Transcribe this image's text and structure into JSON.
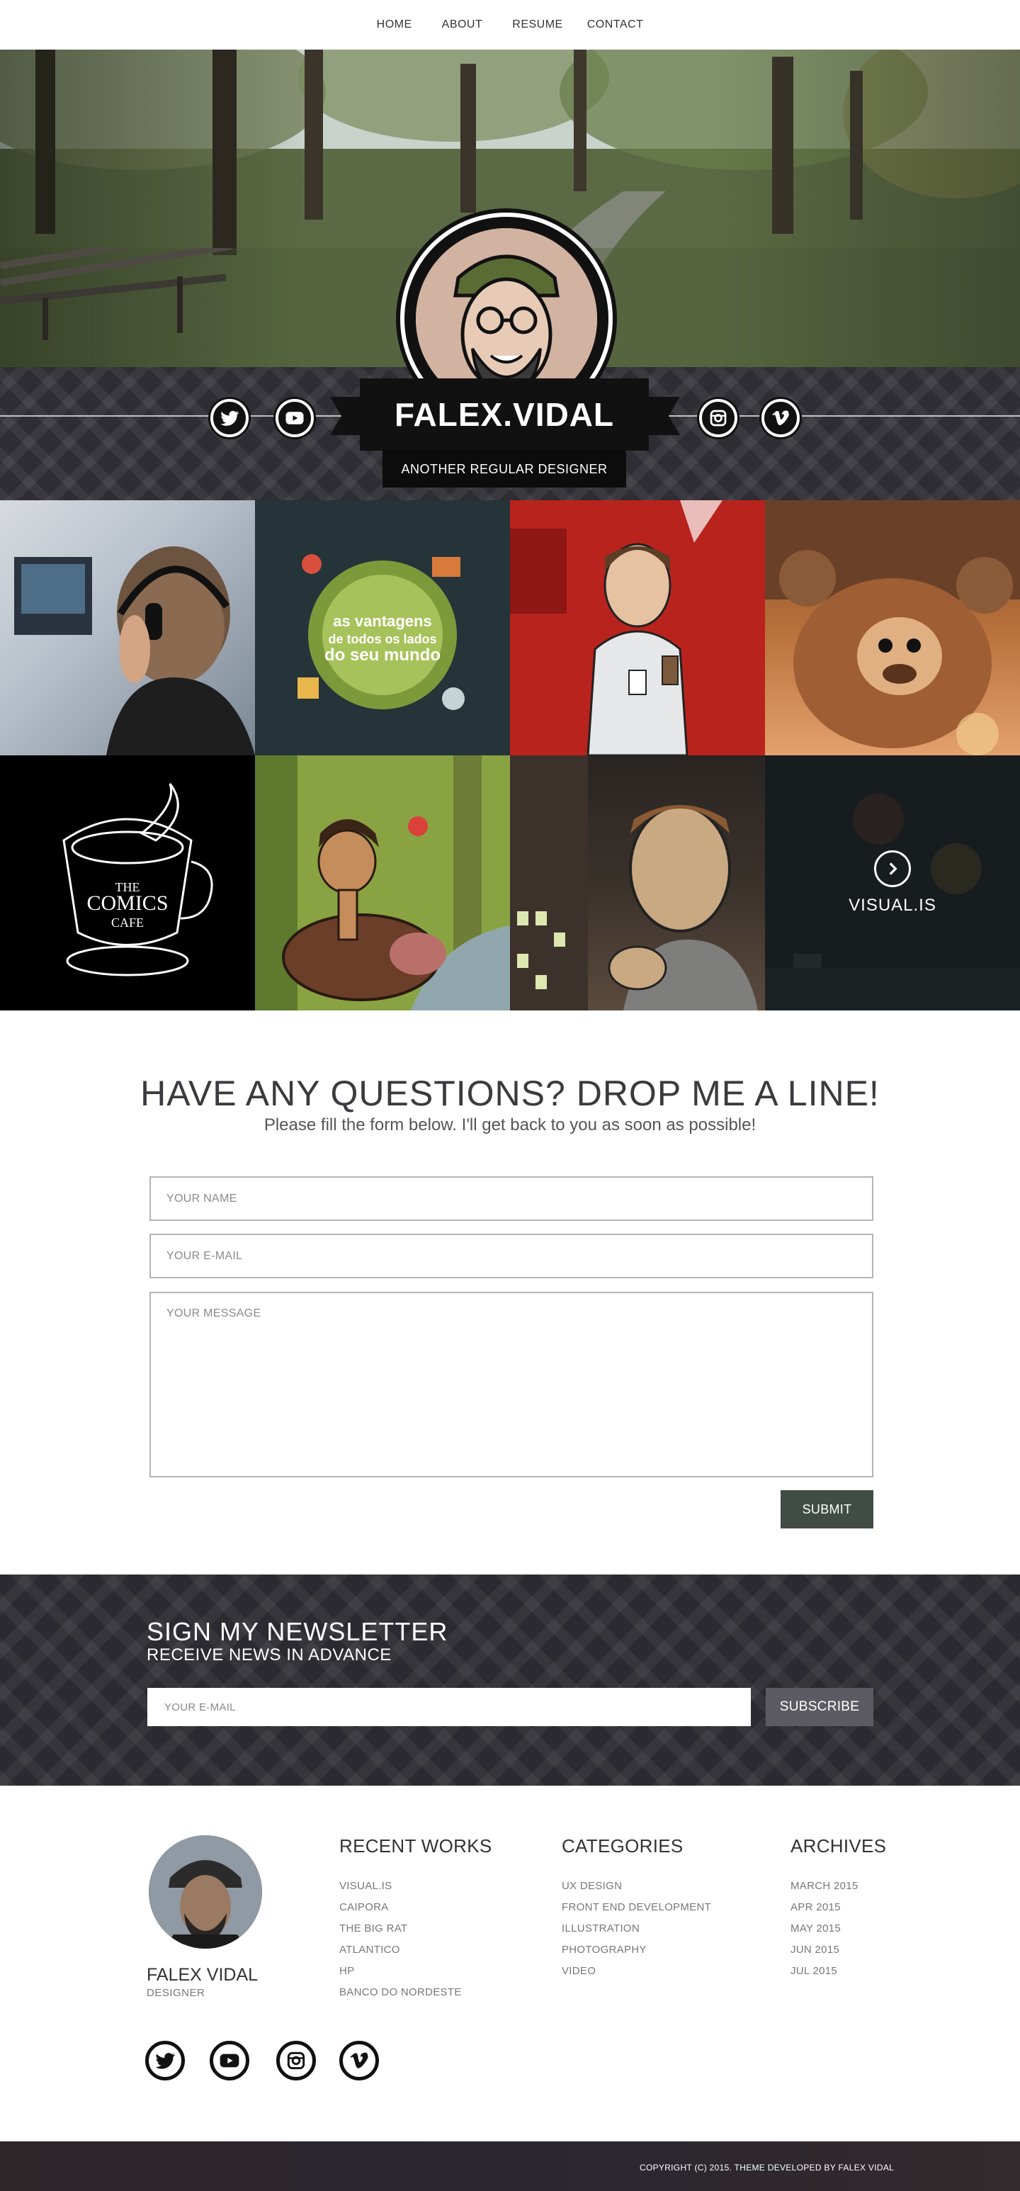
{
  "nav": {
    "items": [
      {
        "label": "HOME"
      },
      {
        "label": "ABOUT"
      },
      {
        "label": "RESUME"
      },
      {
        "label": "CONTACT"
      }
    ]
  },
  "hero": {
    "name": "FALEX.VIDAL",
    "tagline": "ANOTHER REGULAR DESIGNER",
    "social": [
      "twitter-icon",
      "youtube-icon",
      "instagram-icon",
      "vimeo-icon"
    ]
  },
  "portfolio": {
    "featured_label": "VISUAL.IS",
    "tiles": [
      {
        "icon": "photo-headphones"
      },
      {
        "icon": "illustration-world"
      },
      {
        "icon": "illustration-man-badge"
      },
      {
        "icon": "illustration-gorilla"
      },
      {
        "icon": "logo-comics-cafe"
      },
      {
        "icon": "illustration-boy-boar"
      },
      {
        "icon": "illustration-man-window"
      },
      {
        "icon": "visual-is"
      }
    ],
    "comics_logo_text": "THE COMICS CAFE"
  },
  "contact": {
    "title": "HAVE ANY QUESTIONS? DROP ME A LINE!",
    "subtitle": "Please fill the form below. I'll get back to you as soon as possible!",
    "name_placeholder": "YOUR NAME",
    "email_placeholder": "YOUR E-MAIL",
    "message_placeholder": "YOUR MESSAGE",
    "submit_label": "SUBMIT"
  },
  "newsletter": {
    "title": "SIGN MY NEWSLETTER",
    "subtitle": "RECEIVE NEWS IN ADVANCE",
    "email_placeholder": "YOUR E-MAIL",
    "button_label": "SUBSCRIBE"
  },
  "footer": {
    "name": "FALEX VIDAL",
    "role": "DESIGNER",
    "recent_works": {
      "title": "RECENT WORKS",
      "items": [
        "VISUAL.IS",
        "CAIPORA",
        "THE BIG RAT",
        "ATLANTICO",
        "HP",
        "BANCO DO NORDESTE"
      ]
    },
    "categories": {
      "title": "CATEGORIES",
      "items": [
        "UX DESIGN",
        "FRONT END DEVELOPMENT",
        "ILLUSTRATION",
        "PHOTOGRAPHY",
        "VIDEO"
      ]
    },
    "archives": {
      "title": "ARCHIVES",
      "items": [
        "MARCH 2015",
        "APR 2015",
        "MAY 2015",
        "JUN 2015",
        "JUL 2015"
      ]
    },
    "social": [
      "twitter-icon",
      "youtube-icon",
      "instagram-icon",
      "vimeo-icon"
    ],
    "copyright": "COPYRIGHT (C) 2015. THEME DEVELOPED BY FALEX VIDAL"
  },
  "colors": {
    "submit_bg": "#404c45",
    "subscribe_bg": "#5c5b63",
    "dark_pattern": "#2e2d33"
  }
}
